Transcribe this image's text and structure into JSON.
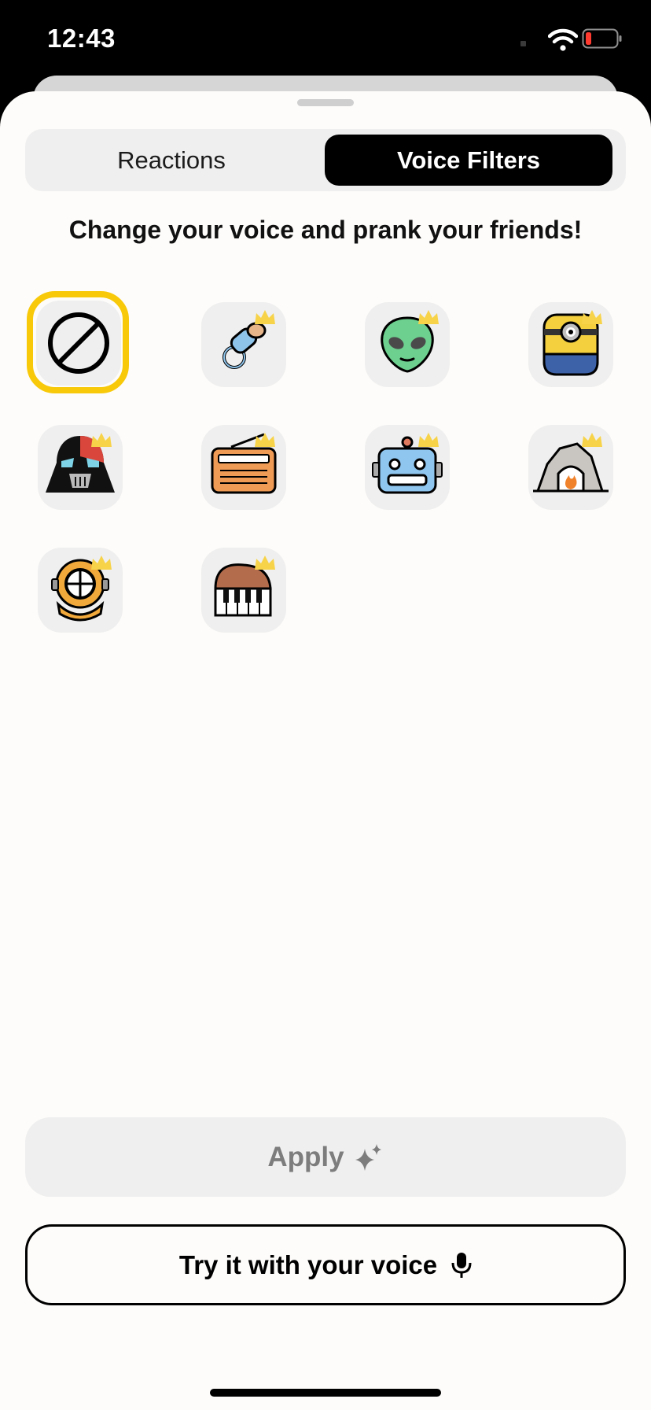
{
  "status_bar": {
    "time": "12:43"
  },
  "tabs": [
    {
      "label": "Reactions",
      "active": false
    },
    {
      "label": "Voice Filters",
      "active": true
    }
  ],
  "headline": "Change your voice and prank your friends!",
  "filters": [
    {
      "icon": "no-filter-icon",
      "selected": true,
      "premium": false
    },
    {
      "icon": "pacifier-icon",
      "selected": false,
      "premium": true
    },
    {
      "icon": "alien-icon",
      "selected": false,
      "premium": true
    },
    {
      "icon": "minion-icon",
      "selected": false,
      "premium": true
    },
    {
      "icon": "darth-vader-icon",
      "selected": false,
      "premium": true
    },
    {
      "icon": "radio-icon",
      "selected": false,
      "premium": true
    },
    {
      "icon": "robot-icon",
      "selected": false,
      "premium": true
    },
    {
      "icon": "cave-icon",
      "selected": false,
      "premium": true
    },
    {
      "icon": "diving-helmet-icon",
      "selected": false,
      "premium": true
    },
    {
      "icon": "piano-icon",
      "selected": false,
      "premium": true
    }
  ],
  "colors": {
    "accent": "#f8c909",
    "crown": "#f7d34a",
    "active_tab": "#000000"
  },
  "buttons": {
    "apply_label": "Apply",
    "try_label": "Try it with your voice"
  }
}
